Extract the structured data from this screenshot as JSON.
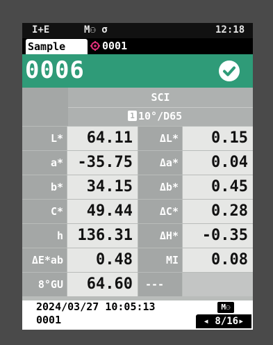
{
  "status": {
    "left": "I+E",
    "mode": "M⚇ σ",
    "time": "12:18"
  },
  "tabs": {
    "sample": "Sample",
    "target_label": "0001"
  },
  "header": {
    "sample_number": "0006"
  },
  "observer": {
    "mode": "SCI",
    "illuminant": "10°/D65",
    "observer_icon": "1"
  },
  "rows": [
    {
      "l1": "L*",
      "v1": "64.11",
      "l2": "ΔL*",
      "v2": "0.15"
    },
    {
      "l1": "a*",
      "v1": "-35.75",
      "l2": "Δa*",
      "v2": "0.04"
    },
    {
      "l1": "b*",
      "v1": "34.15",
      "l2": "Δb*",
      "v2": "0.45"
    },
    {
      "l1": "C*",
      "v1": "49.44",
      "l2": "ΔC*",
      "v2": "0.28"
    },
    {
      "l1": "h",
      "v1": "136.31",
      "l2": "ΔH*",
      "v2": "-0.35"
    },
    {
      "l1": "ΔE*ab",
      "v1": "0.48",
      "l2": "MI",
      "v2": "0.08"
    },
    {
      "l1": "8°GU",
      "v1": "64.60",
      "l2": "---",
      "v2": ""
    }
  ],
  "footer": {
    "datetime": "2024/03/27 10:05:13",
    "target": "0001",
    "memory": "M⚇",
    "page": "◂ 8/16▸"
  },
  "colors": {
    "header": "#2f9b78",
    "frame": "#4a4a4a"
  }
}
